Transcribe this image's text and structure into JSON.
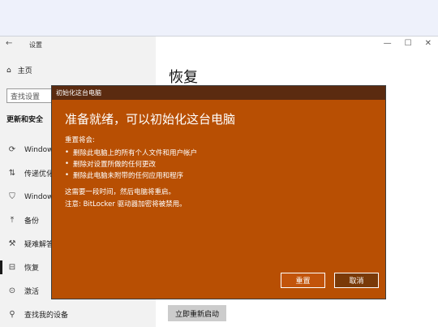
{
  "window": {
    "title": "设置",
    "back_icon": "back-arrow-icon",
    "controls": [
      "—",
      "☐",
      "✕"
    ]
  },
  "sidebar": {
    "home_label": "主页",
    "search_placeholder": "查找设置",
    "section_title": "更新和安全",
    "items": [
      {
        "label": "Windows",
        "icon": "refresh-icon",
        "glyph": "⟳",
        "active": false
      },
      {
        "label": "传递优化",
        "icon": "delivery-icon",
        "glyph": "⇅",
        "active": false
      },
      {
        "label": "Windows",
        "icon": "shield-icon",
        "glyph": "⛉",
        "active": false
      },
      {
        "label": "备份",
        "icon": "backup-icon",
        "glyph": "⤒",
        "active": false
      },
      {
        "label": "疑难解答",
        "icon": "wrench-icon",
        "glyph": "⚒",
        "active": false
      },
      {
        "label": "恢复",
        "icon": "recovery-icon",
        "glyph": "⊟",
        "active": true
      },
      {
        "label": "激活",
        "icon": "activation-icon",
        "glyph": "⊙",
        "active": false
      },
      {
        "label": "查找我的设备",
        "icon": "find-device-icon",
        "glyph": "⚲",
        "active": false
      }
    ]
  },
  "main": {
    "title": "恢复",
    "restart_button": "立即重新启动"
  },
  "dialog": {
    "title": "初始化这台电脑",
    "heading": "准备就绪，可以初始化这台电脑",
    "intro": "重置将会:",
    "bullets": [
      "删除此电脑上的所有个人文件和用户帐户",
      "删除对设置所做的任何更改",
      "删除此电脑未附带的任何应用和程序"
    ],
    "note1": "这需要一段时间，然后电脑将重启。",
    "note2": "注意: BitLocker 驱动器加密将被禁用。",
    "reset_label": "重置",
    "cancel_label": "取消"
  },
  "colors": {
    "dialog_bg": "#b84f03",
    "dialog_titlebar": "#5b2b10",
    "sidebar_bg": "#f2f2f2"
  }
}
